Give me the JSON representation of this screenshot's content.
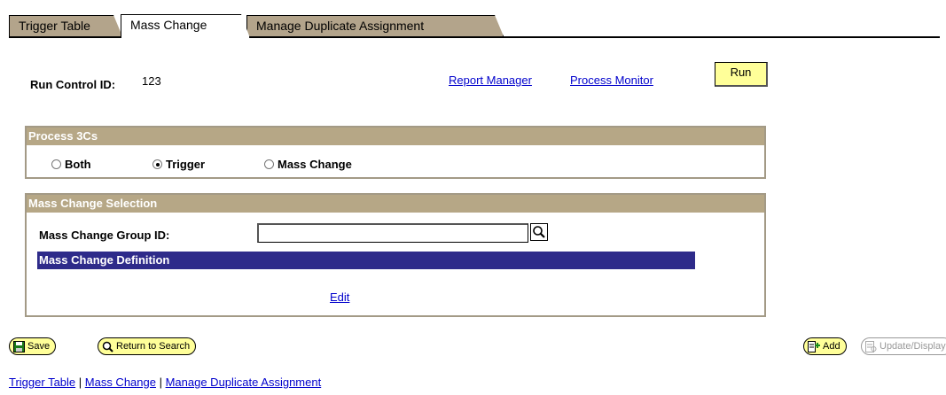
{
  "tabs": [
    {
      "label": "Trigger Table",
      "active": false
    },
    {
      "label": "Mass Change",
      "active": true
    },
    {
      "label": "Manage Duplicate Assignment",
      "active": false
    }
  ],
  "run_control": {
    "label": "Run Control ID:",
    "value": "123",
    "report_manager": "Report Manager",
    "process_monitor": "Process Monitor",
    "run_label": "Run"
  },
  "process_3cs": {
    "title": "Process 3Cs",
    "options": [
      {
        "label": "Both",
        "selected": false
      },
      {
        "label": "Trigger",
        "selected": true
      },
      {
        "label": "Mass Change",
        "selected": false
      }
    ]
  },
  "mass_change_selection": {
    "title": "Mass Change Selection",
    "group_id_label": "Mass Change Group ID:",
    "group_id_value": "",
    "definition_label": "Mass Change Definition",
    "edit_label": "Edit"
  },
  "buttons": {
    "save": "Save",
    "return_to_search": "Return to Search",
    "add": "Add",
    "update_display": "Update/Display"
  },
  "footer_links": {
    "trigger_table": "Trigger Table",
    "separator": " | ",
    "mass_change": "Mass Change",
    "manage_duplicate": "Manage Duplicate Assignment"
  },
  "colors": {
    "tab_inactive": "#b3a48b",
    "group_header": "#b6a786",
    "definition_bar": "#2e2b8a",
    "button_yellow": "#ffff99",
    "link": "#0000cc"
  }
}
